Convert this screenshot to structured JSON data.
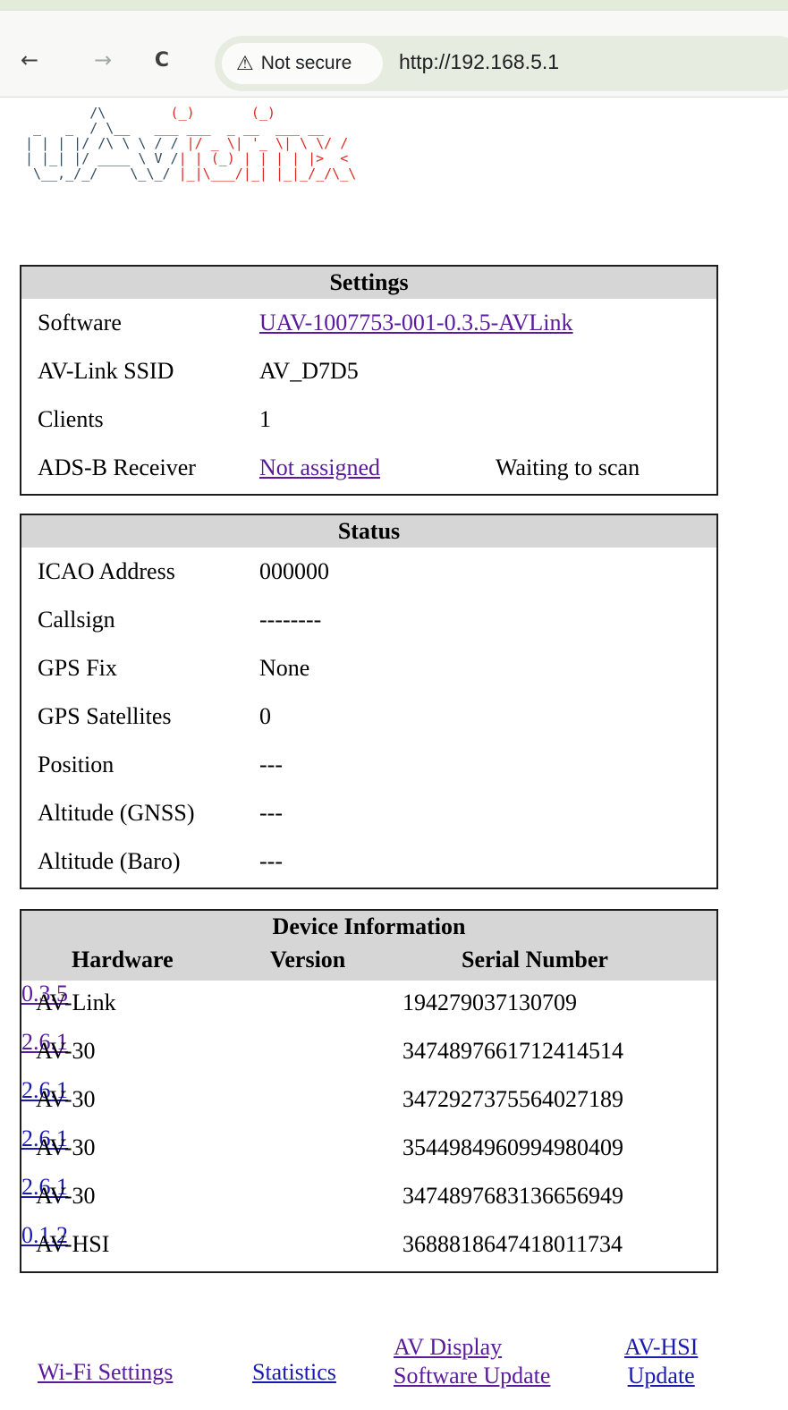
{
  "browser": {
    "security_label": "Not secure",
    "url": "http://192.168.5.1",
    "back_icon": "←",
    "forward_icon": "→",
    "reload_icon": "C",
    "warning_icon": "⚠"
  },
  "logo": {
    "text": "AVIDYNE AV-Link ASCII art logo"
  },
  "settings": {
    "title": "Settings",
    "rows": [
      {
        "label": "Software",
        "value": "UAV-1007753-001-0.3.5-AVLink",
        "link": true
      },
      {
        "label": "AV-Link SSID",
        "value": "AV_D7D5",
        "link": false
      },
      {
        "label": "Clients",
        "value": "1",
        "link": false
      },
      {
        "label": "ADS-B Receiver",
        "value": "Not assigned",
        "link": true,
        "extra": "Waiting to scan"
      }
    ]
  },
  "status": {
    "title": "Status",
    "rows": [
      {
        "label": "ICAO Address",
        "value": "000000"
      },
      {
        "label": "Callsign",
        "value": "--------"
      },
      {
        "label": "GPS Fix",
        "value": "None"
      },
      {
        "label": "GPS Satellites",
        "value": "0"
      },
      {
        "label": "Position",
        "value": "---"
      },
      {
        "label": "Altitude (GNSS)",
        "value": "---"
      },
      {
        "label": "Altitude (Baro)",
        "value": "---"
      }
    ]
  },
  "device_info": {
    "title": "Device Information",
    "columns": [
      "Hardware",
      "Version",
      "Serial Number"
    ],
    "rows": [
      {
        "hardware": "AV-Link",
        "version": "0.3.5",
        "serial": "194279037130709"
      },
      {
        "hardware": "AV-30",
        "version": "2.6.1",
        "serial": "3474897661712414514"
      },
      {
        "hardware": "AV-30",
        "version": "2.6.1",
        "serial": "3472927375564027189"
      },
      {
        "hardware": "AV-30",
        "version": "2.6.1",
        "serial": "3544984960994980409"
      },
      {
        "hardware": "AV-30",
        "version": "2.6.1",
        "serial": "3474897683136656949"
      },
      {
        "hardware": "AV-HSI",
        "version": "0.1.2",
        "serial": "3688818647418011734"
      }
    ]
  },
  "footer": {
    "wifi": "Wi-Fi Settings",
    "statistics": "Statistics",
    "av_display_1": "AV Display",
    "av_display_2": "Software Update",
    "av_hsi_1": "AV-HSI",
    "av_hsi_2": "Update"
  }
}
